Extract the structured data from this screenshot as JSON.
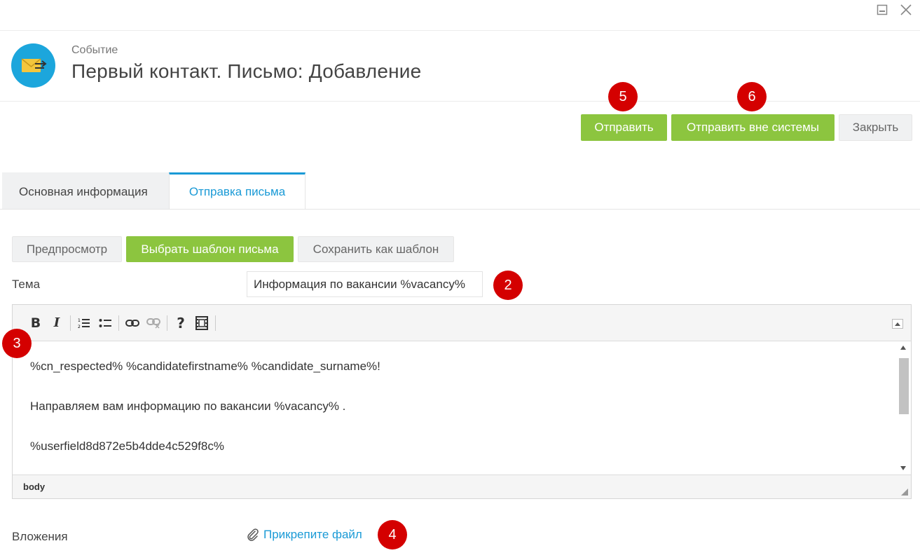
{
  "window": {
    "minimize_icon": "minimize-icon",
    "close_icon": "close-icon"
  },
  "header": {
    "icon": "envelope-arrow-icon",
    "icon_bg_color": "#1ca6dc",
    "subtitle": "Событие",
    "title": "Первый контакт. Письмо: Добавление"
  },
  "actions": {
    "send_label": "Отправить",
    "send_outside_label": "Отправить вне системы",
    "close_label": "Закрыть"
  },
  "badges": [
    "5",
    "6",
    "2",
    "3",
    "4"
  ],
  "tabs": [
    {
      "label": "Основная информация",
      "active": false
    },
    {
      "label": "Отправка письма",
      "active": true
    }
  ],
  "template_buttons": {
    "preview_label": "Предпросмотр",
    "choose_template_label": "Выбрать шаблон письма",
    "save_template_label": "Сохранить как шаблон"
  },
  "subject": {
    "label": "Тема",
    "value": "Информация по вакансии %vacancy%"
  },
  "editor": {
    "toolbar": [
      "bold-icon",
      "italic-icon",
      "numbered-list-icon",
      "bulleted-list-icon",
      "link-icon",
      "unlink-icon",
      "help-icon",
      "media-icon"
    ],
    "lines": [
      "%cn_respected% %candidatefirstname% %candidate_surname%!",
      "Направляем вам информацию по вакансии %vacancy% .",
      "%userfield8d872e5b4dde4c529f8c%"
    ],
    "status_path": "body"
  },
  "attachments": {
    "label": "Вложения",
    "link_label": "Прикрепите файл"
  },
  "colors": {
    "accent_green": "#8cc53f",
    "accent_blue": "#1a9ad6",
    "badge_red": "#d40000"
  }
}
